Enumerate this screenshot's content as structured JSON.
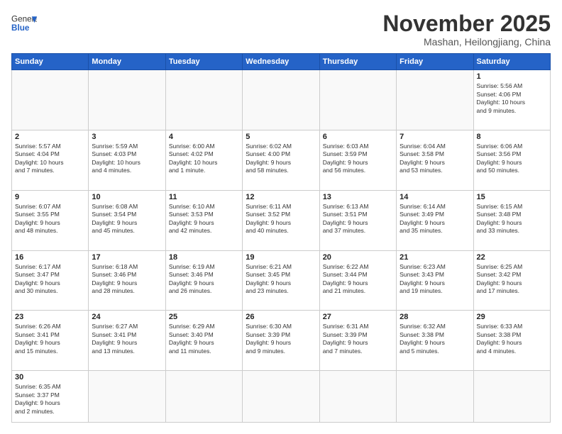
{
  "header": {
    "logo_general": "General",
    "logo_blue": "Blue",
    "month_title": "November 2025",
    "location": "Mashan, Heilongjiang, China"
  },
  "weekdays": [
    "Sunday",
    "Monday",
    "Tuesday",
    "Wednesday",
    "Thursday",
    "Friday",
    "Saturday"
  ],
  "weeks": [
    [
      {
        "day": "",
        "info": ""
      },
      {
        "day": "",
        "info": ""
      },
      {
        "day": "",
        "info": ""
      },
      {
        "day": "",
        "info": ""
      },
      {
        "day": "",
        "info": ""
      },
      {
        "day": "",
        "info": ""
      },
      {
        "day": "1",
        "info": "Sunrise: 5:56 AM\nSunset: 4:06 PM\nDaylight: 10 hours\nand 9 minutes."
      }
    ],
    [
      {
        "day": "2",
        "info": "Sunrise: 5:57 AM\nSunset: 4:04 PM\nDaylight: 10 hours\nand 7 minutes."
      },
      {
        "day": "3",
        "info": "Sunrise: 5:59 AM\nSunset: 4:03 PM\nDaylight: 10 hours\nand 4 minutes."
      },
      {
        "day": "4",
        "info": "Sunrise: 6:00 AM\nSunset: 4:02 PM\nDaylight: 10 hours\nand 1 minute."
      },
      {
        "day": "5",
        "info": "Sunrise: 6:02 AM\nSunset: 4:00 PM\nDaylight: 9 hours\nand 58 minutes."
      },
      {
        "day": "6",
        "info": "Sunrise: 6:03 AM\nSunset: 3:59 PM\nDaylight: 9 hours\nand 56 minutes."
      },
      {
        "day": "7",
        "info": "Sunrise: 6:04 AM\nSunset: 3:58 PM\nDaylight: 9 hours\nand 53 minutes."
      },
      {
        "day": "8",
        "info": "Sunrise: 6:06 AM\nSunset: 3:56 PM\nDaylight: 9 hours\nand 50 minutes."
      }
    ],
    [
      {
        "day": "9",
        "info": "Sunrise: 6:07 AM\nSunset: 3:55 PM\nDaylight: 9 hours\nand 48 minutes."
      },
      {
        "day": "10",
        "info": "Sunrise: 6:08 AM\nSunset: 3:54 PM\nDaylight: 9 hours\nand 45 minutes."
      },
      {
        "day": "11",
        "info": "Sunrise: 6:10 AM\nSunset: 3:53 PM\nDaylight: 9 hours\nand 42 minutes."
      },
      {
        "day": "12",
        "info": "Sunrise: 6:11 AM\nSunset: 3:52 PM\nDaylight: 9 hours\nand 40 minutes."
      },
      {
        "day": "13",
        "info": "Sunrise: 6:13 AM\nSunset: 3:51 PM\nDaylight: 9 hours\nand 37 minutes."
      },
      {
        "day": "14",
        "info": "Sunrise: 6:14 AM\nSunset: 3:49 PM\nDaylight: 9 hours\nand 35 minutes."
      },
      {
        "day": "15",
        "info": "Sunrise: 6:15 AM\nSunset: 3:48 PM\nDaylight: 9 hours\nand 33 minutes."
      }
    ],
    [
      {
        "day": "16",
        "info": "Sunrise: 6:17 AM\nSunset: 3:47 PM\nDaylight: 9 hours\nand 30 minutes."
      },
      {
        "day": "17",
        "info": "Sunrise: 6:18 AM\nSunset: 3:46 PM\nDaylight: 9 hours\nand 28 minutes."
      },
      {
        "day": "18",
        "info": "Sunrise: 6:19 AM\nSunset: 3:46 PM\nDaylight: 9 hours\nand 26 minutes."
      },
      {
        "day": "19",
        "info": "Sunrise: 6:21 AM\nSunset: 3:45 PM\nDaylight: 9 hours\nand 23 minutes."
      },
      {
        "day": "20",
        "info": "Sunrise: 6:22 AM\nSunset: 3:44 PM\nDaylight: 9 hours\nand 21 minutes."
      },
      {
        "day": "21",
        "info": "Sunrise: 6:23 AM\nSunset: 3:43 PM\nDaylight: 9 hours\nand 19 minutes."
      },
      {
        "day": "22",
        "info": "Sunrise: 6:25 AM\nSunset: 3:42 PM\nDaylight: 9 hours\nand 17 minutes."
      }
    ],
    [
      {
        "day": "23",
        "info": "Sunrise: 6:26 AM\nSunset: 3:41 PM\nDaylight: 9 hours\nand 15 minutes."
      },
      {
        "day": "24",
        "info": "Sunrise: 6:27 AM\nSunset: 3:41 PM\nDaylight: 9 hours\nand 13 minutes."
      },
      {
        "day": "25",
        "info": "Sunrise: 6:29 AM\nSunset: 3:40 PM\nDaylight: 9 hours\nand 11 minutes."
      },
      {
        "day": "26",
        "info": "Sunrise: 6:30 AM\nSunset: 3:39 PM\nDaylight: 9 hours\nand 9 minutes."
      },
      {
        "day": "27",
        "info": "Sunrise: 6:31 AM\nSunset: 3:39 PM\nDaylight: 9 hours\nand 7 minutes."
      },
      {
        "day": "28",
        "info": "Sunrise: 6:32 AM\nSunset: 3:38 PM\nDaylight: 9 hours\nand 5 minutes."
      },
      {
        "day": "29",
        "info": "Sunrise: 6:33 AM\nSunset: 3:38 PM\nDaylight: 9 hours\nand 4 minutes."
      }
    ],
    [
      {
        "day": "30",
        "info": "Sunrise: 6:35 AM\nSunset: 3:37 PM\nDaylight: 9 hours\nand 2 minutes."
      },
      {
        "day": "",
        "info": ""
      },
      {
        "day": "",
        "info": ""
      },
      {
        "day": "",
        "info": ""
      },
      {
        "day": "",
        "info": ""
      },
      {
        "day": "",
        "info": ""
      },
      {
        "day": "",
        "info": ""
      }
    ]
  ]
}
